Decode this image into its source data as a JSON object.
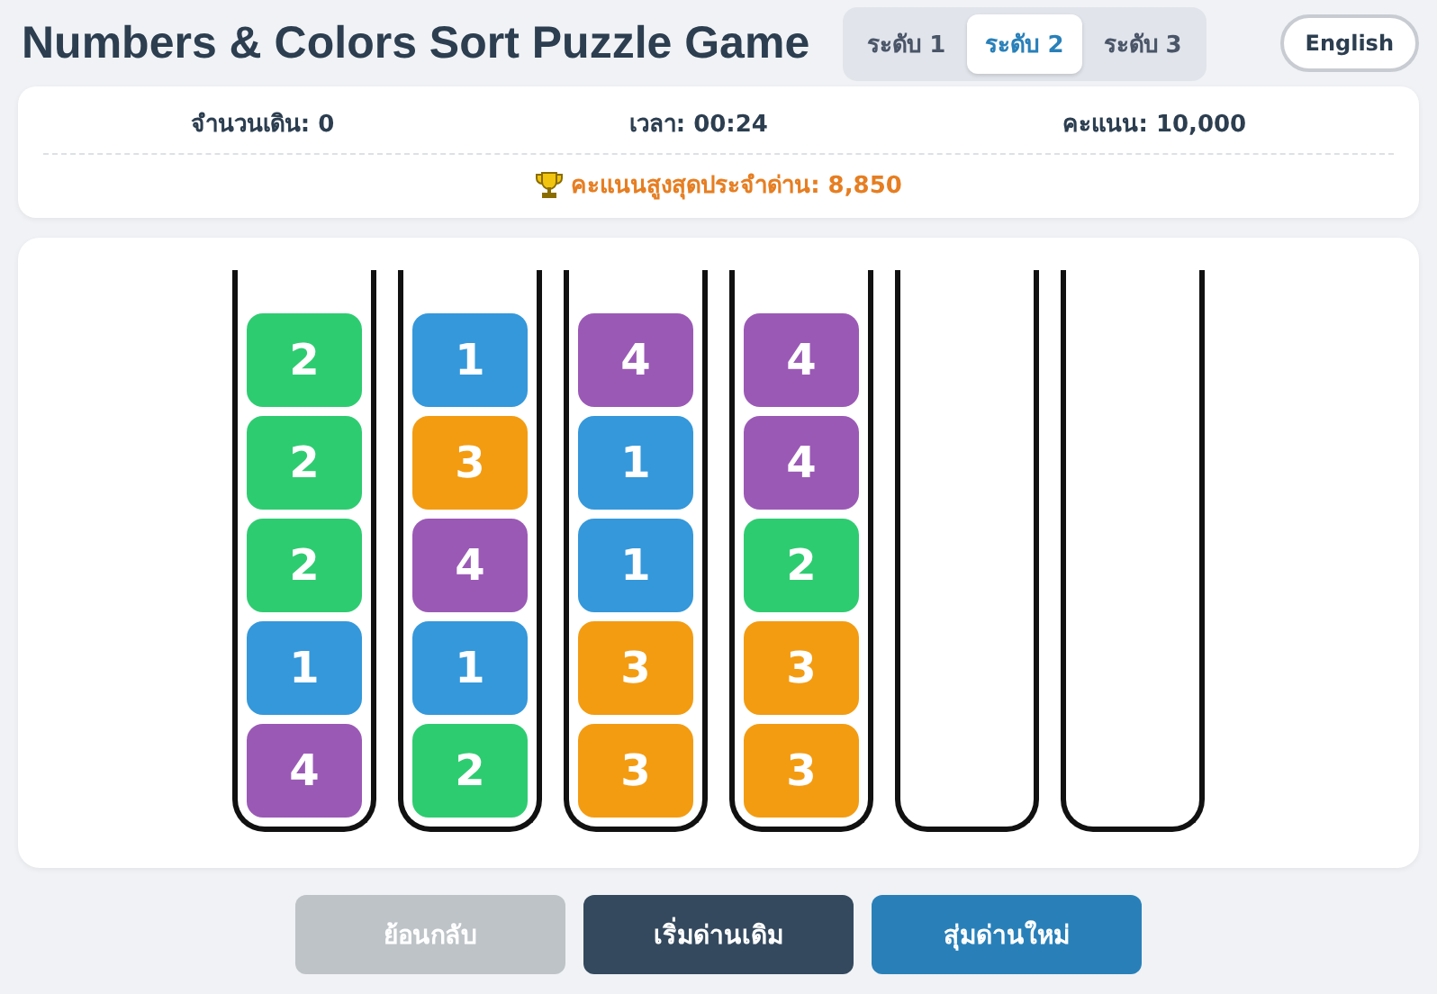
{
  "title": "Numbers & Colors Sort Puzzle Game",
  "levels": [
    {
      "label": "ระดับ 1",
      "selected": false
    },
    {
      "label": "ระดับ 2",
      "selected": true
    },
    {
      "label": "ระดับ 3",
      "selected": false
    }
  ],
  "language_button": "English",
  "stats": [
    {
      "label": "จำนวนเดิน:",
      "value": "0"
    },
    {
      "label": "เวลา:",
      "value": "00:24"
    },
    {
      "label": "คะแนน:",
      "value": "10,000"
    }
  ],
  "best_score": "คะแนนสูงสุดประจำด่าน: 8,850",
  "tubes": [
    {
      "kind": "filled",
      "blocks": [
        {
          "text": "2",
          "color": "#2ecc71"
        },
        {
          "text": "2",
          "color": "#2ecc71"
        },
        {
          "text": "2",
          "color": "#2ecc71"
        },
        {
          "text": "1",
          "color": "#3498db"
        },
        {
          "text": "4",
          "color": "#9b59b6"
        }
      ]
    },
    {
      "kind": "filled",
      "blocks": [
        {
          "text": "1",
          "color": "#3498db"
        },
        {
          "text": "3",
          "color": "#f39c12"
        },
        {
          "text": "4",
          "color": "#9b59b6"
        },
        {
          "text": "1",
          "color": "#3498db"
        },
        {
          "text": "2",
          "color": "#2ecc71"
        }
      ]
    },
    {
      "kind": "filled",
      "blocks": [
        {
          "text": "4",
          "color": "#9b59b6"
        },
        {
          "text": "1",
          "color": "#3498db"
        },
        {
          "text": "1",
          "color": "#3498db"
        },
        {
          "text": "3",
          "color": "#f39c12"
        },
        {
          "text": "3",
          "color": "#f39c12"
        }
      ]
    },
    {
      "kind": "filled",
      "blocks": [
        {
          "text": "4",
          "color": "#9b59b6"
        },
        {
          "text": "4",
          "color": "#9b59b6"
        },
        {
          "text": "2",
          "color": "#2ecc71"
        },
        {
          "text": "3",
          "color": "#f39c12"
        },
        {
          "text": "3",
          "color": "#f39c12"
        }
      ]
    },
    {
      "kind": "empty"
    },
    {
      "kind": "empty"
    }
  ],
  "buttons": [
    {
      "label": "ย้อนกลับ",
      "kind": "undo",
      "disabled": true
    },
    {
      "label": "เริ่มด่านเดิม",
      "kind": "restart",
      "disabled": false
    },
    {
      "label": "สุ่มด่านใหม่",
      "kind": "new",
      "disabled": false
    }
  ]
}
